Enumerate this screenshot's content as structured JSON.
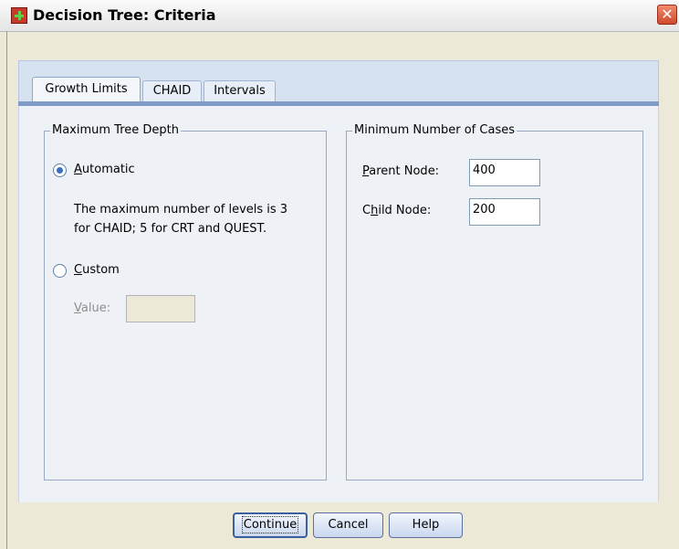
{
  "window": {
    "title": "Decision Tree: Criteria",
    "icon": "app-icon",
    "close_icon": "close-icon",
    "close_glyph": "✕"
  },
  "tabs": [
    {
      "label": "Growth Limits",
      "active": true
    },
    {
      "label": "CHAID",
      "active": false
    },
    {
      "label": "Intervals",
      "active": false
    }
  ],
  "max_depth": {
    "legend": "Maximum Tree Depth",
    "automatic": {
      "label_rest": "utomatic",
      "mnemonic": "A",
      "checked": true
    },
    "description_line1": "The maximum number of levels is 3",
    "description_line2": "for CHAID; 5 for CRT and QUEST.",
    "custom": {
      "label_rest": "ustom",
      "mnemonic": "C",
      "checked": false
    },
    "value": {
      "label_rest": "alue:",
      "mnemonic": "V",
      "value": "",
      "enabled": false
    }
  },
  "min_cases": {
    "legend": "Minimum Number of Cases",
    "parent": {
      "label_rest": "arent Node:",
      "mnemonic": "P",
      "value": "400"
    },
    "child": {
      "label_pre": "C",
      "mnemonic": "h",
      "label_rest": "ild Node:",
      "value": "200"
    }
  },
  "buttons": {
    "continue": "Continue",
    "cancel": "Cancel",
    "help": "Help"
  },
  "colors": {
    "title_bar": "#f0f0f0",
    "tab_accent": "#7f9bc6",
    "close_button": "#d04a2c"
  }
}
